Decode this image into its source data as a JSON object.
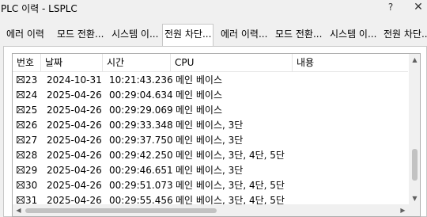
{
  "window": {
    "title": "PLC 이력 - LSPLC",
    "help_label": "?",
    "close_label": "✕"
  },
  "tabs": [
    {
      "label": "에러 이력"
    },
    {
      "label": "모드 전환..."
    },
    {
      "label": "시스템 이..."
    },
    {
      "label": "전원 차단..."
    },
    {
      "label": "에러 이력..."
    },
    {
      "label": "모드 전환..."
    },
    {
      "label": "시스템 이..."
    },
    {
      "label": "전원 차단..."
    }
  ],
  "table": {
    "columns": [
      "번호",
      "날짜",
      "시간",
      "CPU",
      "내용"
    ],
    "rows": [
      {
        "no": "23",
        "date": "2024-10-31",
        "time": "10:21:43.236",
        "cpu": "메인 베이스",
        "content": ""
      },
      {
        "no": "24",
        "date": "2025-04-26",
        "time": "00:29:04.634",
        "cpu": "메인 베이스",
        "content": ""
      },
      {
        "no": "25",
        "date": "2025-04-26",
        "time": "00:29:29.069",
        "cpu": "메인 베이스",
        "content": ""
      },
      {
        "no": "26",
        "date": "2025-04-26",
        "time": "00:29:33.348",
        "cpu": "메인 베이스, 3단",
        "content": ""
      },
      {
        "no": "27",
        "date": "2025-04-26",
        "time": "00:29:37.750",
        "cpu": "메인 베이스, 3단",
        "content": ""
      },
      {
        "no": "28",
        "date": "2025-04-26",
        "time": "00:29:42.250",
        "cpu": "메인 베이스, 3단, 4단, 5단",
        "content": ""
      },
      {
        "no": "29",
        "date": "2025-04-26",
        "time": "00:29:46.651",
        "cpu": "메인 베이스, 3단",
        "content": ""
      },
      {
        "no": "30",
        "date": "2025-04-26",
        "time": "00:29:51.073",
        "cpu": "메인 베이스, 3단, 4단, 5단",
        "content": ""
      },
      {
        "no": "31",
        "date": "2025-04-26",
        "time": "00:29:55.456",
        "cpu": "메인 베이스, 3단, 4단, 5단",
        "content": ""
      }
    ]
  },
  "icons": {
    "row_icon": "mail-icon"
  }
}
